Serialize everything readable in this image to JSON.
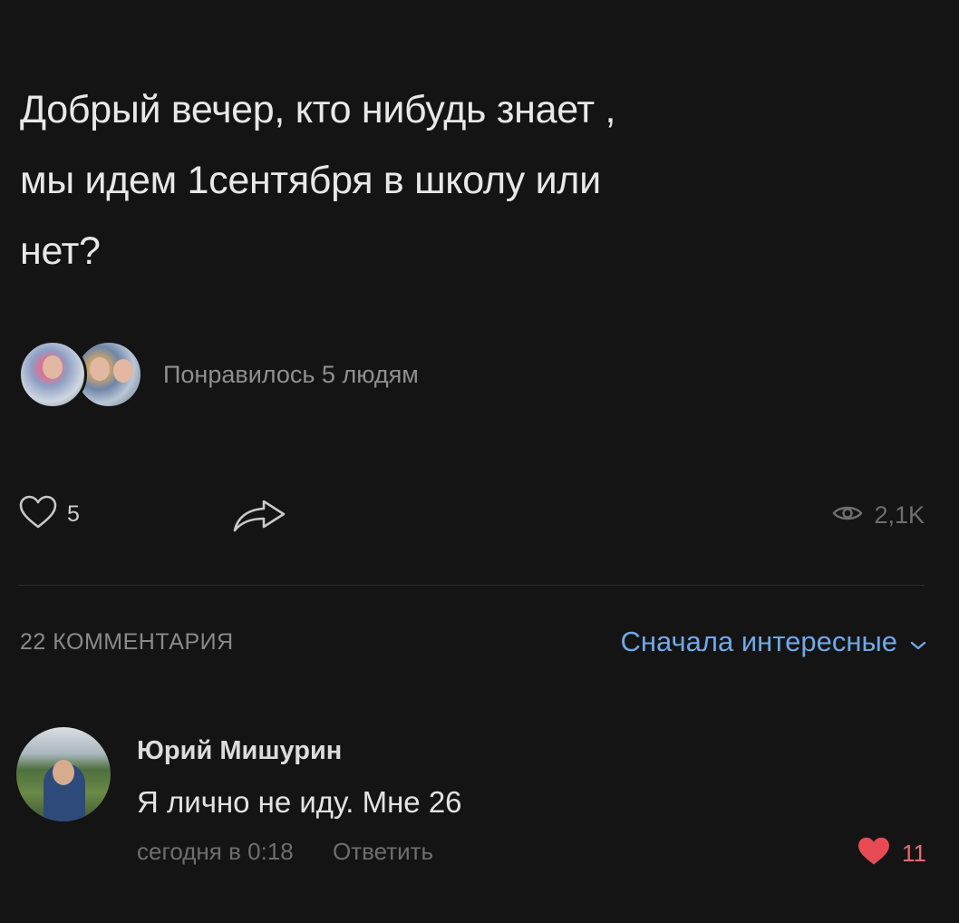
{
  "post": {
    "text_lines": [
      "Добрый вечер, кто нибудь знает ,",
      "мы идем 1сентября в школу или",
      "нет?"
    ]
  },
  "likes_summary": {
    "text": "Понравилось 5 людям"
  },
  "actions": {
    "like_count": "5",
    "views_count": "2,1K"
  },
  "comments_header": {
    "count_label": "22 КОММЕНТАРИЯ",
    "sort_label": "Сначала интересные"
  },
  "comment": {
    "author": "Юрий Мишурин",
    "text": "Я лично не иду. Мне 26",
    "time": "сегодня в 0:18",
    "reply_label": "Ответить",
    "like_count": "11"
  },
  "colors": {
    "background": "#141414",
    "accent_link": "#6fa8e6",
    "liked_heart": "#e64b55"
  },
  "icons": {
    "like": "heart-outline-icon",
    "share": "share-arrow-icon",
    "views": "eye-icon",
    "sort": "chevron-down-icon",
    "comment_like": "heart-filled-icon"
  }
}
